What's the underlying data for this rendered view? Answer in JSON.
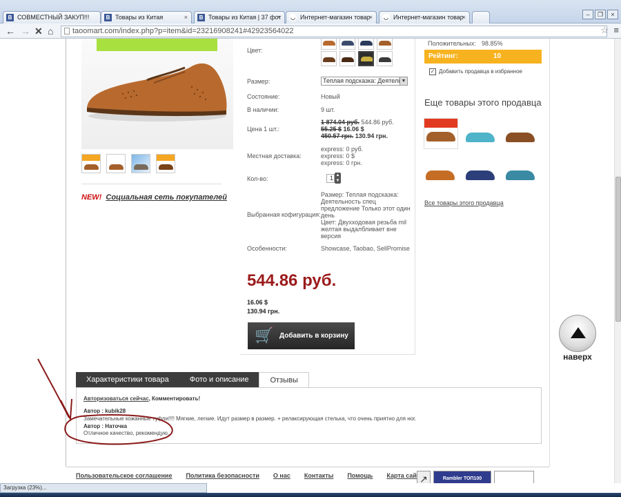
{
  "browser": {
    "tabs": [
      {
        "label": "СОВМЕСТНЫЙ ЗАКУП!!!",
        "icon": "В"
      },
      {
        "label": "Товары из Китая",
        "icon": "В"
      },
      {
        "label": "Товары из Китая | 37 фот",
        "icon": "В"
      },
      {
        "label": "Интернет-магазин товар",
        "icon": "◡"
      },
      {
        "label": "Интернет-магазин товар",
        "icon": "◡"
      }
    ],
    "tab_close": "×",
    "url": "taoomart.com/index.php?p=item&id=23216908241#42923564022",
    "status": "Загрузка (23%)..."
  },
  "product": {
    "color_label": "Цвет:",
    "size_label": "Размер:",
    "size_value": "Теплая подсказка: Деятелі",
    "condition_label": "Состояние:",
    "condition_value": "Новый",
    "stock_label": "В наличии:",
    "stock_value": "9 шт.",
    "price_label": "Цена 1 шт.:",
    "price_old_rub": "1 874.04 руб.",
    "price_new_rub": "544.86 руб.",
    "price_old_usd": "55.25 $",
    "price_new_usd": "16.06 $",
    "price_old_uah": "450.57 грн.",
    "price_new_uah": "130.94 грн.",
    "delivery_label": "Местная доставка:",
    "delivery_lines": [
      "express: 0 руб.",
      "express: 0 $",
      "express: 0 грн."
    ],
    "qty_label": "Кол-во:",
    "qty_value": "1",
    "config_label": "Выбранная кофигурация:",
    "config_lines": [
      "Размер: Теплая подсказка:",
      "Деятельность спец",
      "предложение Только этот один",
      "день",
      "Цвет: Двухходовая резьба mil",
      "желтая выдалбливает вне",
      "версия"
    ],
    "features_label": "Особенности:",
    "features_value": "Showcase, Taobao, SellPromise",
    "big_price": "544.86 руб.",
    "usd_price": "16.06 $",
    "uah_price": "130.94 грн.",
    "cart_button": "Добавить в корзину"
  },
  "social": {
    "new_label": "NEW!",
    "link": "Социальная сеть покупателей"
  },
  "seller": {
    "positive_label": "Положительных:",
    "positive_value": "98.85%",
    "rating_label": "Рейтинг:",
    "rating_value": "10",
    "favorite_label": "Добавить продавца в избранное",
    "more_title": "Еще товары этого продавца",
    "all_link": "Все товары этого продавца"
  },
  "to_top": "наверх",
  "tabs": [
    "Характеристики товара",
    "Фото и описание",
    "Отзывы"
  ],
  "reviews": {
    "auth_link": "Авторизоваться сейчас",
    "auth_suffix": ", Комментировать!",
    "items": [
      {
        "author_prefix": "Автор :",
        "author": "kubik28",
        "text": "Замечательные кожанные туфли!!!! Мягкие, легкие. Идут размер в размер. + релаксирующая стелька, что очень приятно для ног."
      },
      {
        "author_prefix": "Автор :",
        "author": "Наточка",
        "text": "Отличное качество, рекомендую."
      }
    ]
  },
  "footer": {
    "links": [
      "Пользовательское соглашение",
      "Политика безопасности",
      "О нас",
      "Контакты",
      "Помощь",
      "Карта сайта"
    ],
    "counter_label": "Rambler ТОП100"
  },
  "colors": {
    "price_red": "#9b1b1b",
    "rating_orange": "#f7b21f",
    "new_red": "#d01010",
    "annotation": "#8b1a1a"
  }
}
